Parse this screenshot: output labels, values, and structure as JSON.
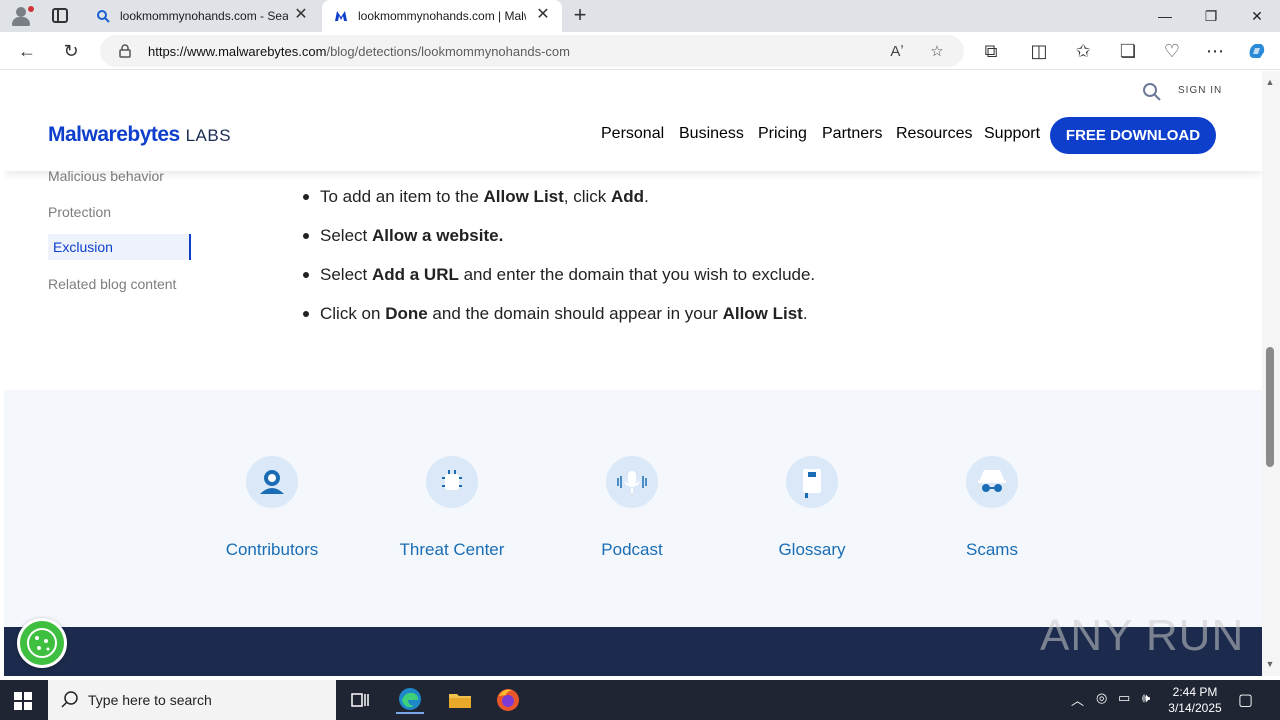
{
  "browser": {
    "tabs": [
      {
        "title": "lookmommynohands.com - Search",
        "active": false
      },
      {
        "title": "lookmommynohands.com | Malwarebytes",
        "active": true
      }
    ],
    "new_tab": "+",
    "window_controls": {
      "minimize": "—",
      "maximize": "❐",
      "close": "✕"
    },
    "url_host": "https://www.malwarebytes.com",
    "url_path": "/blog/detections/lookmommynohands-com",
    "read_aloud": "Aʼ"
  },
  "site": {
    "logo_main": "Malwarebytes",
    "logo_sub": "LABS",
    "sign_in": "SIGN IN",
    "nav": [
      "Personal",
      "Business",
      "Pricing",
      "Partners",
      "Resources",
      "Support"
    ],
    "download_button": "FREE DOWNLOAD",
    "accent_color": "#0d3ecc"
  },
  "sidebar": {
    "items": [
      {
        "label": "Malicious behavior",
        "active": false
      },
      {
        "label": "Protection",
        "active": false
      },
      {
        "label": "Exclusion",
        "active": true
      },
      {
        "label": "Related blog content",
        "active": false
      }
    ]
  },
  "steps": [
    {
      "pre": "To add an item to the ",
      "b1": "Allow List",
      "mid": ", click ",
      "b2": "Add",
      "post": "."
    },
    {
      "pre": "Select ",
      "b1": "Allow a website.",
      "mid": "",
      "b2": "",
      "post": ""
    },
    {
      "pre": "Select ",
      "b1": "Add a URL",
      "mid": " and enter the domain that you wish to exclude.",
      "b2": "",
      "post": ""
    },
    {
      "pre": "Click on ",
      "b1": "Done",
      "mid": " and the domain should appear in your ",
      "b2": "Allow List",
      "post": "."
    }
  ],
  "footer_links": [
    {
      "label": "Contributors",
      "icon": "contributor-icon"
    },
    {
      "label": "Threat Center",
      "icon": "threat-center-icon"
    },
    {
      "label": "Podcast",
      "icon": "podcast-icon"
    },
    {
      "label": "Glossary",
      "icon": "glossary-icon"
    },
    {
      "label": "Scams",
      "icon": "scams-icon"
    }
  ],
  "watermark": "ANY RUN",
  "taskbar": {
    "search_placeholder": "Type here to search",
    "time": "2:44 PM",
    "date": "3/14/2025"
  }
}
